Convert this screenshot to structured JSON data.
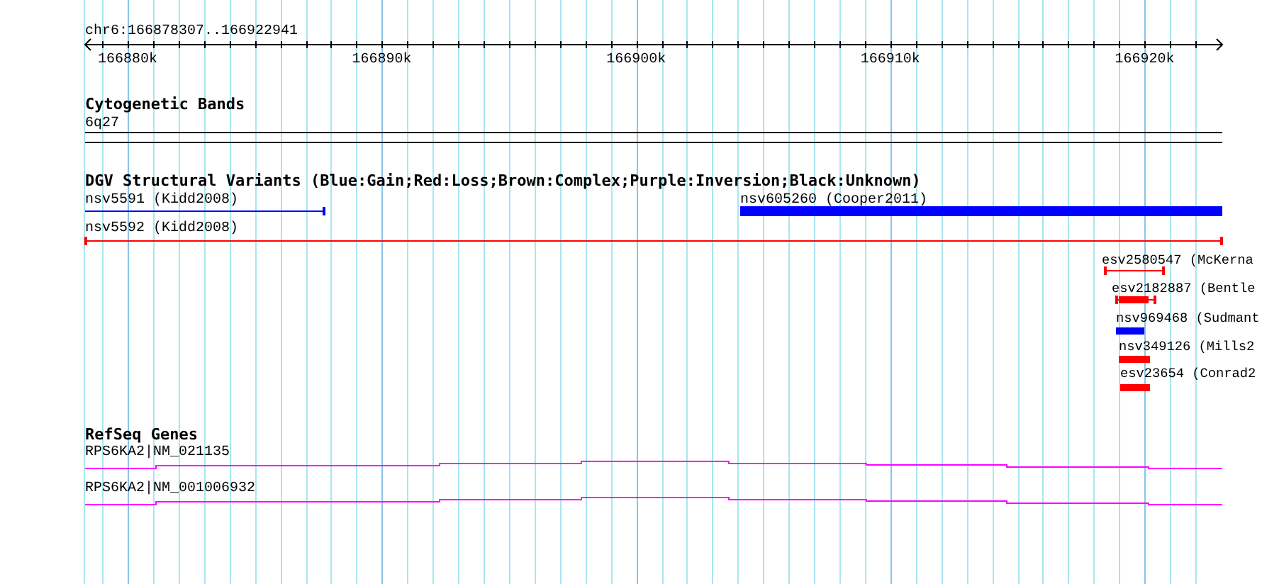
{
  "ruler": {
    "region": "chr6:166878307..166922941",
    "ticks": [
      "166880k",
      "166890k",
      "166900k",
      "166910k",
      "166920k"
    ]
  },
  "tracks": [
    {
      "kind": "bands",
      "title": "Cytogenetic Bands",
      "features": [
        {
          "label": "6q27"
        }
      ]
    },
    {
      "kind": "variants",
      "title": "DGV Structural Variants (Blue:Gain;Red:Loss;Brown:Complex;Purple:Inversion;Black:Unknown)",
      "features": [
        {
          "label": "nsv5591 (Kidd2008)",
          "color": "#0000ff"
        },
        {
          "label": "nsv605260 (Cooper2011)",
          "color": "#0000ff"
        },
        {
          "label": "nsv5592 (Kidd2008)",
          "color": "#ff0000"
        },
        {
          "label": "esv2580547 (McKerna",
          "color": "#ff0000"
        },
        {
          "label": "esv2182887 (Bentle",
          "color": "#ff0000"
        },
        {
          "label": "nsv969468 (Sudmant",
          "color": "#0000ff"
        },
        {
          "label": "nsv349126 (Mills2",
          "color": "#ff0000"
        },
        {
          "label": "esv23654 (Conrad2",
          "color": "#ff0000"
        }
      ]
    },
    {
      "kind": "genes",
      "title": "RefSeq Genes",
      "features": [
        {
          "label": "RPS6KA2|NM_021135"
        },
        {
          "label": "RPS6KA2|NM_001006932"
        }
      ]
    }
  ]
}
